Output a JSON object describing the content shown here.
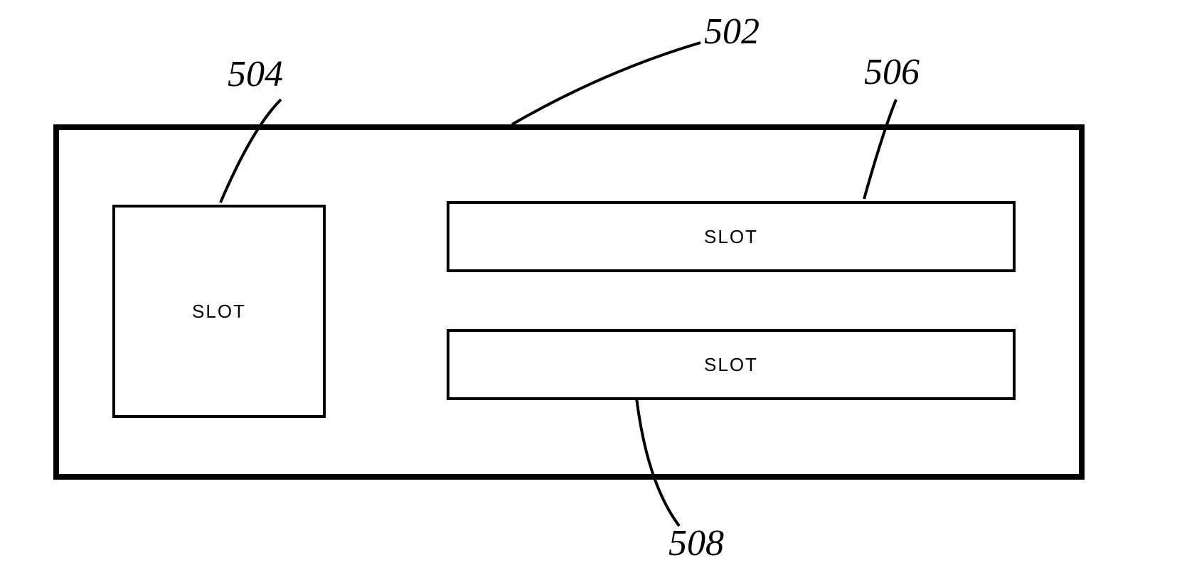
{
  "labels": {
    "ref502": "502",
    "ref504": "504",
    "ref506": "506",
    "ref508": "508"
  },
  "slots": {
    "square": "SLOT",
    "rectTop": "SLOT",
    "rectBottom": "SLOT"
  }
}
